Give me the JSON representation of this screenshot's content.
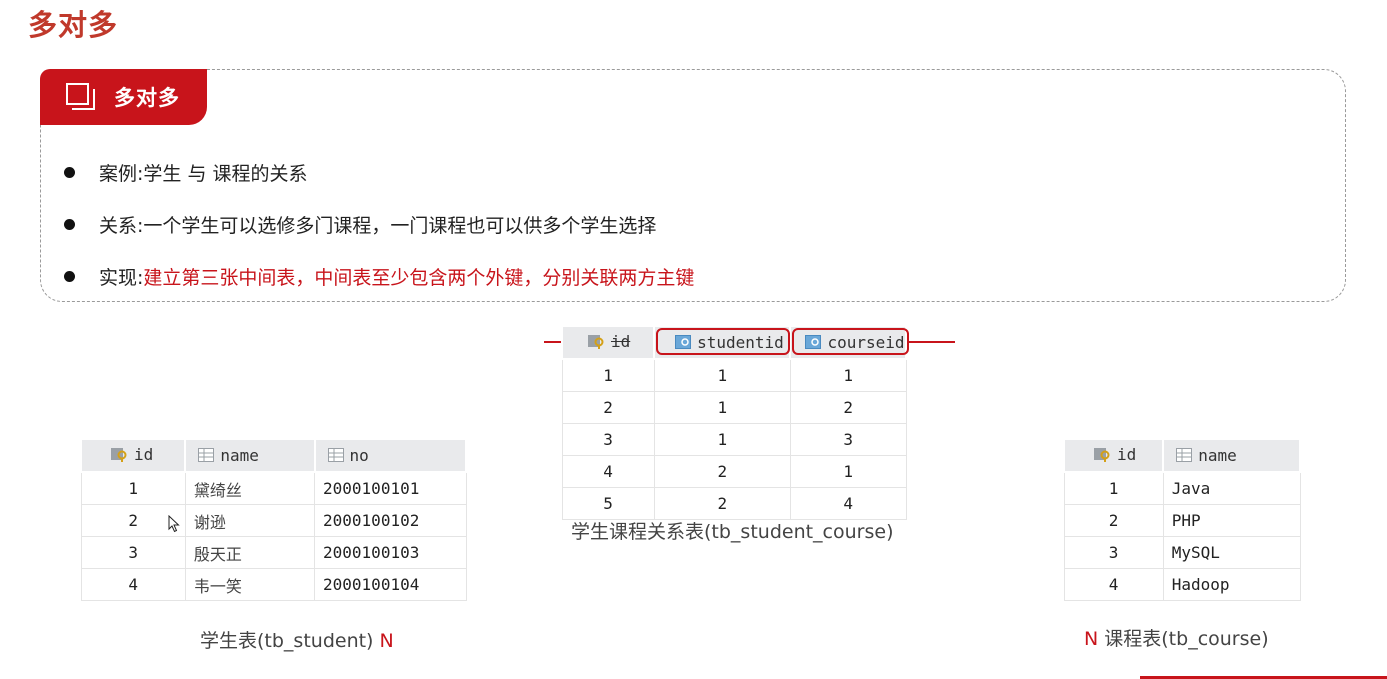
{
  "page": {
    "title": "多对多"
  },
  "card": {
    "tab_label": "多对多",
    "bullets": [
      {
        "prefix": "案例: ",
        "text": "学生 与 课程的关系",
        "highlight": ""
      },
      {
        "prefix": "关系: ",
        "text": "一个学生可以选修多门课程，一门课程也可以供多个学生选择",
        "highlight": ""
      },
      {
        "prefix": "实现: ",
        "text": "",
        "highlight": "建立第三张中间表，中间表至少包含两个外键，分别关联两方主键"
      }
    ]
  },
  "tables": {
    "student": {
      "columns": [
        "id",
        "name",
        "no"
      ],
      "rows": [
        [
          "1",
          "黛绮丝",
          "2000100101"
        ],
        [
          "2",
          "谢逊",
          "2000100102"
        ],
        [
          "3",
          "殷天正",
          "2000100103"
        ],
        [
          "4",
          "韦一笑",
          "2000100104"
        ]
      ],
      "caption": "学生表(tb_student)",
      "cardinality": "N"
    },
    "student_course": {
      "columns": [
        "id",
        "studentid",
        "courseid"
      ],
      "rows": [
        [
          "1",
          "1",
          "1"
        ],
        [
          "2",
          "1",
          "2"
        ],
        [
          "3",
          "1",
          "3"
        ],
        [
          "4",
          "2",
          "1"
        ],
        [
          "5",
          "2",
          "4"
        ]
      ],
      "caption": "学生课程关系表(tb_student_course)"
    },
    "course": {
      "columns": [
        "id",
        "name"
      ],
      "rows": [
        [
          "1",
          "Java"
        ],
        [
          "2",
          "PHP"
        ],
        [
          "3",
          "MySQL"
        ],
        [
          "4",
          "Hadoop"
        ]
      ],
      "caption": "课程表(tb_course)",
      "cardinality": "N"
    }
  },
  "colors": {
    "accent": "#c8141b",
    "header_bg": "#e9eaec"
  },
  "icons": {
    "tab": "window-stack-icon",
    "key": "key-icon",
    "column": "column-icon",
    "foreign_key": "foreign-key-icon"
  }
}
